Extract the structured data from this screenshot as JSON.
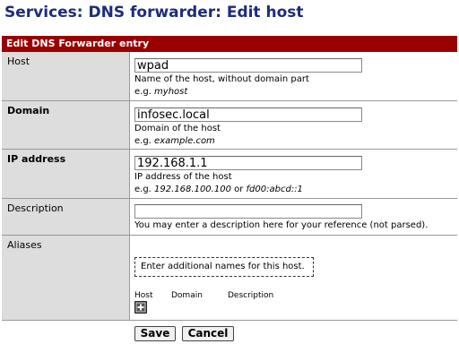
{
  "page": {
    "title": "Services: DNS forwarder: Edit host"
  },
  "section": {
    "header": "Edit DNS Forwarder entry"
  },
  "host": {
    "label": "Host",
    "value": "wpad",
    "help": "Name of the host, without domain part",
    "example_prefix": "e.g. ",
    "example": "myhost"
  },
  "domain": {
    "label": "Domain",
    "value": "infosec.local",
    "help": "Domain of the host",
    "example_prefix": "e.g. ",
    "example": "example.com"
  },
  "ip": {
    "label": "IP address",
    "value": "192.168.1.1",
    "help": "IP address of the host",
    "example_prefix": "e.g. ",
    "example_a": "192.168.100.100",
    "example_or": " or ",
    "example_b": "fd00:abcd::1"
  },
  "description": {
    "label": "Description",
    "value": "",
    "help": "You may enter a description here for your reference (not parsed)."
  },
  "aliases": {
    "label": "Aliases",
    "box_text": "Enter additional names for this host.",
    "columns": [
      "Host",
      "Domain",
      "Description"
    ],
    "add_icon": "plus-icon"
  },
  "buttons": {
    "save": "Save",
    "cancel": "Cancel"
  },
  "colors": {
    "title": "#1c2d7a",
    "header_bg": "#990000",
    "label_bg": "#dddddd"
  }
}
